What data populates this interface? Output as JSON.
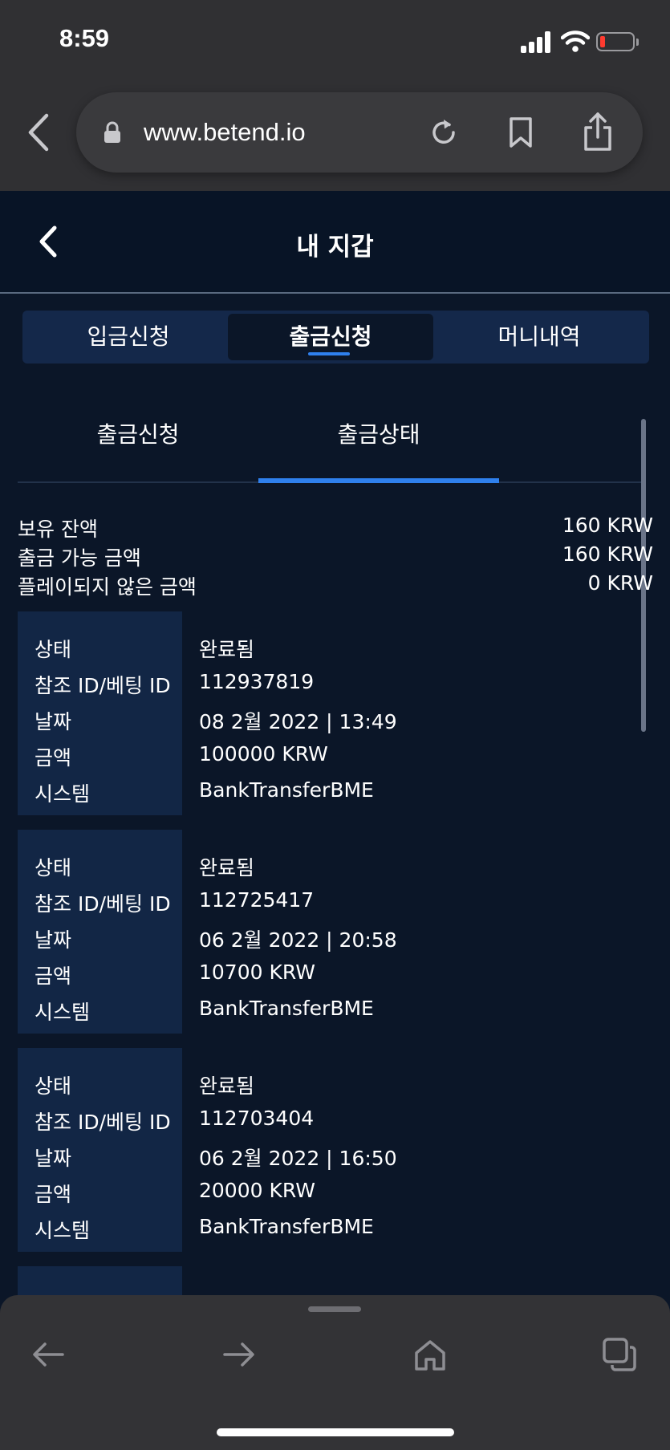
{
  "status_bar": {
    "time": "8:59"
  },
  "browser": {
    "url": "www.betend.io",
    "icons": [
      "back-icon",
      "lock-icon",
      "reload-icon",
      "bookmark-icon",
      "share-icon"
    ]
  },
  "header": {
    "title": "내 지갑"
  },
  "main_tabs": [
    {
      "label": "입금신청",
      "active": false
    },
    {
      "label": "출금신청",
      "active": true
    },
    {
      "label": "머니내역",
      "active": false
    }
  ],
  "sub_tabs": [
    {
      "label": "출금신청",
      "active": false
    },
    {
      "label": "출금상태",
      "active": true
    }
  ],
  "balances": [
    {
      "label": "보유 잔액",
      "value": "160 KRW"
    },
    {
      "label": "출금 가능 금액",
      "value": "160 KRW"
    },
    {
      "label": "플레이되지 않은 금액",
      "value": "0 KRW"
    }
  ],
  "field_labels": {
    "status": "상태",
    "ref_id": "참조 ID/베팅 ID",
    "date": "날짜",
    "amount": "금액",
    "system": "시스템"
  },
  "transactions": [
    {
      "status": "완료됨",
      "ref_id": "112937819",
      "date": "08 2월 2022 | 13:49",
      "amount": "100000 KRW",
      "system": "BankTransferBME"
    },
    {
      "status": "완료됨",
      "ref_id": "112725417",
      "date": "06 2월 2022 | 20:58",
      "amount": "10700 KRW",
      "system": "BankTransferBME"
    },
    {
      "status": "완료됨",
      "ref_id": "112703404",
      "date": "06 2월 2022 | 16:50",
      "amount": "20000 KRW",
      "system": "BankTransferBME"
    }
  ],
  "toolbar_icons": [
    "back-arrow-icon",
    "forward-arrow-icon",
    "home-icon",
    "tabs-icon"
  ],
  "colors": {
    "page_bg": "#0b1628",
    "card_label_bg": "#122645",
    "tab_bar_bg": "#14284a",
    "accent": "#2f80ed",
    "browser_chrome": "#303033"
  }
}
